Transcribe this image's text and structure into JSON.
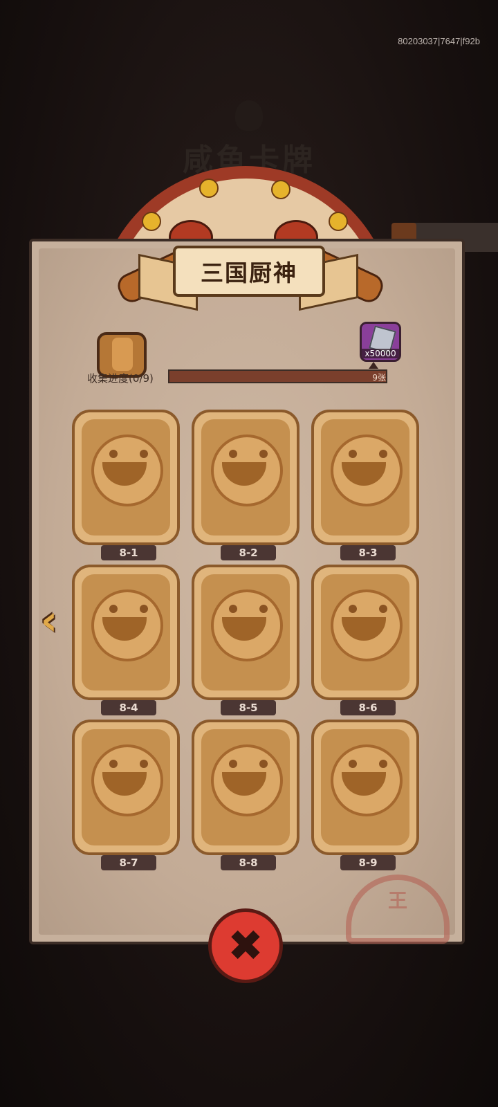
{
  "debug_id": "80203037|7647|f92b",
  "background": {
    "title": "咸鱼卡牌"
  },
  "header": {
    "title": "三国厨神"
  },
  "progress": {
    "label": "收集进度(0/9)",
    "collected": 0,
    "total": 9,
    "milestone_label": "9张",
    "reward_amount": "x50000",
    "reward_icon": "diamond-gem-icon"
  },
  "cards": [
    {
      "label": "8-1",
      "icon": "locked-card-icon"
    },
    {
      "label": "8-2",
      "icon": "locked-card-icon"
    },
    {
      "label": "8-3",
      "icon": "locked-card-icon"
    },
    {
      "label": "8-4",
      "icon": "locked-card-icon"
    },
    {
      "label": "8-5",
      "icon": "locked-card-icon"
    },
    {
      "label": "8-6",
      "icon": "locked-card-icon"
    },
    {
      "label": "8-7",
      "icon": "locked-card-icon"
    },
    {
      "label": "8-8",
      "icon": "locked-card-icon"
    },
    {
      "label": "8-9",
      "icon": "locked-card-icon"
    }
  ],
  "nav": {
    "prev_glyph": "‹"
  },
  "close": {
    "glyph": "✖"
  },
  "stamp": {
    "text": "王"
  },
  "colors": {
    "close": "#dd3b31",
    "progress_track": "#7a3f2c",
    "card": "#e0b57c"
  }
}
